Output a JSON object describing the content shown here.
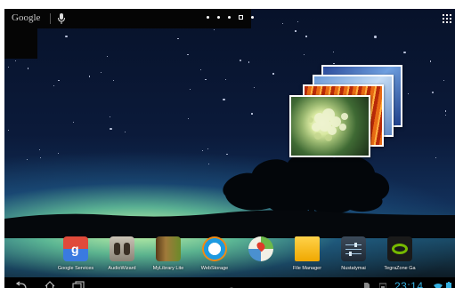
{
  "search": {
    "logo": "Google",
    "icon": "mic-icon"
  },
  "home": {
    "page_count": 5,
    "current_page": 4,
    "apps_icon": "all-apps-icon"
  },
  "dock": {
    "apps": [
      {
        "label": "Google Services",
        "icon": "google-services-icon"
      },
      {
        "label": "AudioWizard",
        "icon": "audiowizard-icon"
      },
      {
        "label": "MyLibrary Lite",
        "icon": "mylibrary-icon"
      },
      {
        "label": "WebStorage",
        "icon": "webstorage-icon"
      },
      {
        "label": "",
        "icon": "maps-icon"
      },
      {
        "label": "File Manager",
        "icon": "file-manager-icon"
      },
      {
        "label": "Nustatymai",
        "icon": "settings-icon"
      },
      {
        "label": "TegraZone Ga",
        "icon": "tegrazone-icon"
      }
    ]
  },
  "statusbar": {
    "time": "23:14",
    "accent": "#35b0e0"
  },
  "navbar": {
    "back": "back-icon",
    "home": "home-icon",
    "recents": "recents-icon"
  }
}
